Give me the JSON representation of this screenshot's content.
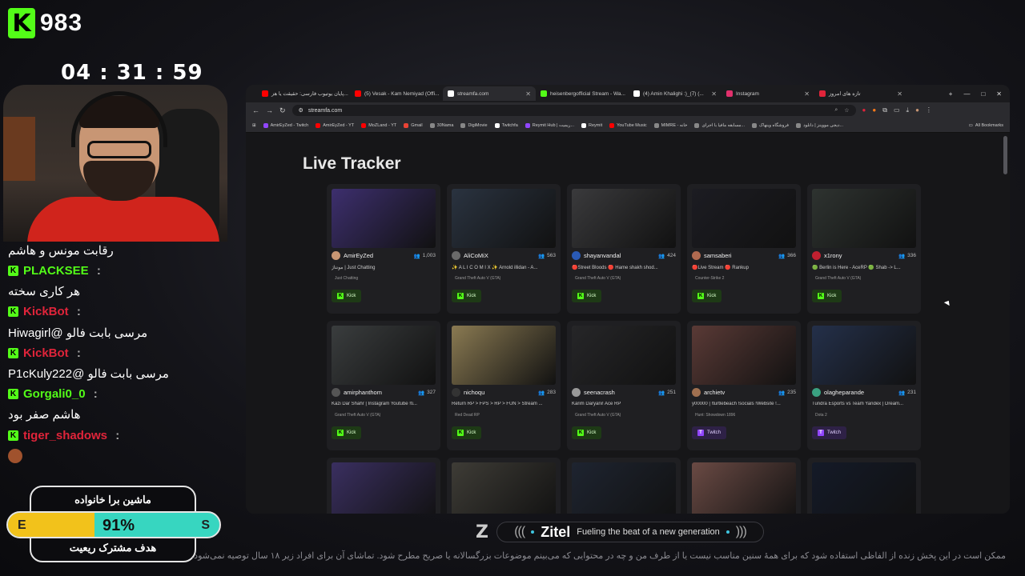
{
  "overlay": {
    "viewer_count": "983",
    "timer": "04 : 31 : 59",
    "chat": [
      {
        "type": "msg",
        "text": "رقابت مونس و هاشم"
      },
      {
        "type": "user",
        "name": "PLACKSEE",
        "color": "#53fc18"
      },
      {
        "type": "msg",
        "text": "هر کاری سخته"
      },
      {
        "type": "user",
        "name": "KickBot",
        "color": "#e0243a"
      },
      {
        "type": "msg",
        "text": "مرسی بابت فالو @Hiwagirl"
      },
      {
        "type": "user",
        "name": "KickBot",
        "color": "#e0243a"
      },
      {
        "type": "msg",
        "text": "مرسی بابت فالو @P1cKuly222"
      },
      {
        "type": "user",
        "name": "Gorgali0_0",
        "color": "#53fc18"
      },
      {
        "type": "msg",
        "text": "هاشم صفر بود"
      },
      {
        "type": "user",
        "name": "tiger_shadows",
        "color": "#e0243a"
      }
    ],
    "goal": {
      "title": "ماشین برا خانواده",
      "subtitle": "هدف مشترک ریعیت",
      "left_label": "E",
      "right_label": "S",
      "percent_text": "91%",
      "percent": 0.41
    }
  },
  "browser": {
    "tabs": [
      {
        "label": "پایان یوتیوب فارسی: حقیقت یا هز...",
        "color": "#ff0000"
      },
      {
        "label": "(5) Vesak - Kam Nemiyad (Offi...",
        "color": "#ff0000"
      },
      {
        "label": "streamfa.com",
        "color": "#ffffff",
        "active": true
      },
      {
        "label": "heisenbergofficial Stream - Wa...",
        "color": "#53fc18"
      },
      {
        "label": "(4) Amin Khalighi :)_(7) (...",
        "color": "#ffffff"
      },
      {
        "label": "Instagram",
        "color": "#e1306c"
      },
      {
        "label": "تازه های امروز",
        "color": "#e0243a"
      }
    ],
    "url": "streamfa.com",
    "bookmarks": [
      {
        "label": "AmirEyZed - Twitch",
        "color": "#9146ff"
      },
      {
        "label": "AmirEyZed - YT",
        "color": "#ff0000"
      },
      {
        "label": "MoZLand - YT",
        "color": "#ff0000"
      },
      {
        "label": "Gmail",
        "color": "#ea4335"
      },
      {
        "label": "30Nama",
        "color": "#888888"
      },
      {
        "label": "DigiMovie",
        "color": "#888888"
      },
      {
        "label": "Twitchfa",
        "color": "#ffffff"
      },
      {
        "label": "Reymit Hub | ریمیت...",
        "color": "#9146ff"
      },
      {
        "label": "Reymit",
        "color": "#ffffff"
      },
      {
        "label": "YouTube Music",
        "color": "#ff0000"
      },
      {
        "label": "MIMRE - خانه",
        "color": "#888888"
      },
      {
        "label": "مسابقه مافیا با اجرای...",
        "color": "#888888"
      },
      {
        "label": "فروشگاه وینهاک",
        "color": "#888888"
      },
      {
        "label": "دیجی مووینز | دانلود...",
        "color": "#888888"
      }
    ],
    "all_bookmarks": "All Bookmarks",
    "page_title": "Live Tracker",
    "cards": [
      {
        "name": "AmirEyZed",
        "viewers": "1,003",
        "title": "مونتاژ | Just Chatting",
        "category": "Just Chatting",
        "platform": "Kick",
        "thumb": "#3d2f6e",
        "avatar": "#c89674"
      },
      {
        "name": "AliCoMiX",
        "viewers": "563",
        "title": "✨ A L I C O M I X ✨ Arnold illidan - A...",
        "category": "Grand Theft Auto V (GTA)",
        "platform": "Kick",
        "thumb": "#2a3340",
        "avatar": "#6a6a6a"
      },
      {
        "name": "shayanvandal",
        "viewers": "424",
        "title": "🔴Street Bloods 🔴 Hame shakh shod...",
        "category": "Grand Theft Auto V (GTA)",
        "platform": "Kick",
        "thumb": "#3a3a3c",
        "avatar": "#2a5ab5"
      },
      {
        "name": "samsaberi",
        "viewers": "366",
        "title": "🔴Live Stream 🔴 Rankup",
        "category": "Counter-Strike 2",
        "platform": "Kick",
        "thumb": "#1c1c22",
        "avatar": "#b06a50"
      },
      {
        "name": "x1rony",
        "viewers": "336",
        "title": "🟢 Berlin is Here - AceRP 🟢 Shab -> L...",
        "category": "Grand Theft Auto V (GTA)",
        "platform": "Kick",
        "thumb": "#2e3330",
        "avatar": "#c02030"
      },
      {
        "name": "amirphanthom",
        "viewers": "327",
        "title": "Kazi Dar Shahr | Instagram Youtube !ti...",
        "category": "Grand Theft Auto V (GTA)",
        "platform": "Kick",
        "thumb": "#3a3d3e",
        "avatar": "#555555"
      },
      {
        "name": "nichoqu",
        "viewers": "283",
        "title": "Return RP > FPS > RP > FUN > Stream ...",
        "category": "Red Dead RP",
        "platform": "Kick",
        "thumb": "#8a7a52",
        "avatar": "#333333"
      },
      {
        "name": "seenacrash",
        "viewers": "251",
        "title": "Karim Daryani! Ace RP",
        "category": "Grand Theft Auto V (GTA)",
        "platform": "Kick",
        "thumb": "#262628",
        "avatar": "#999999"
      },
      {
        "name": "archietv",
        "viewers": "235",
        "title": "y00000 | !turtlebeach !socials !Website !...",
        "category": "Hunt: Showdown 1896",
        "platform": "Twitch",
        "thumb": "#5a3a36",
        "avatar": "#a07050"
      },
      {
        "name": "olagheparande",
        "viewers": "231",
        "title": "Tundra Esports vs Team Yandex | Dream...",
        "category": "Dota 2",
        "platform": "Twitch",
        "thumb": "#24304a",
        "avatar": "#3aa080"
      },
      {
        "name": "",
        "viewers": "",
        "title": "",
        "category": "",
        "platform": "",
        "thumb": "#3a2f60",
        "avatar": "#888888"
      },
      {
        "name": "",
        "viewers": "",
        "title": "",
        "category": "",
        "platform": "",
        "thumb": "#3e3c36",
        "avatar": "#888888"
      },
      {
        "name": "",
        "viewers": "",
        "title": "",
        "category": "",
        "platform": "",
        "thumb": "#1e2430",
        "avatar": "#888888"
      },
      {
        "name": "",
        "viewers": "",
        "title": "",
        "category": "",
        "platform": "",
        "thumb": "#6a4a44",
        "avatar": "#888888"
      },
      {
        "name": "",
        "viewers": "",
        "title": "",
        "category": "",
        "platform": "",
        "thumb": "#141a28",
        "avatar": "#888888"
      }
    ]
  },
  "sponsor": {
    "name": "Zitel",
    "tagline": "Fueling the beat of a new generation"
  },
  "disclaimer": "ممکن است در این پخش زنده از الفاظی استفاده شود که برای همهٔ سنین مناسب نیست یا از طرف من و چه در محتوایی که می‌بینم موضوعات بزرگسالانه یا صریح مطرح شود. تماشای آن برای افراد زیر ۱۸ سال توصیه نمی‌شود."
}
